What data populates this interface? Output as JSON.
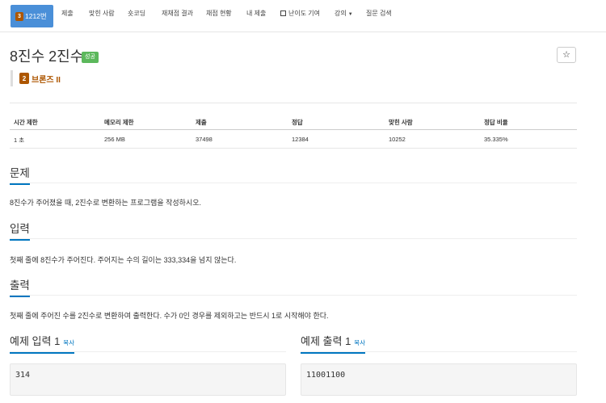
{
  "nav": {
    "active": {
      "tier": "3",
      "label": "1212번"
    },
    "items": [
      "제출",
      "맞힌 사람",
      "숏코딩",
      "재채점 결과",
      "채점 현황",
      "내 제출",
      "난이도 기여",
      "강의",
      "질문 검색"
    ]
  },
  "problem": {
    "title": "8진수 2진수",
    "status": "성공",
    "star": "☆",
    "tier_num": "2",
    "tier_label": "브론즈 II"
  },
  "table": {
    "headers": [
      "시간 제한",
      "메모리 제한",
      "제출",
      "정답",
      "맞힌 사람",
      "정답 비율"
    ],
    "values": [
      "1 초",
      "256 MB",
      "37498",
      "12384",
      "10252",
      "35.335%"
    ]
  },
  "sections": {
    "problem_title": "문제",
    "problem_text": "8진수가 주어졌을 때, 2진수로 변환하는 프로그램을 작성하시오.",
    "input_title": "입력",
    "input_text": "첫째 줄에 8진수가 주어진다. 주어지는 수의 길이는 333,334을 넘지 않는다.",
    "output_title": "출력",
    "output_text": "첫째 줄에 주어진 수를 2진수로 변환하여 출력한다. 수가 0인 경우를 제외하고는 반드시 1로 시작해야 한다."
  },
  "examples": {
    "input_title": "예제 입력 1",
    "output_title": "예제 출력 1",
    "copy": "복사",
    "input_value": "314",
    "output_value": "11001100"
  },
  "colors": {
    "accent": "#0076c0",
    "nav_active": "#4a8fd8",
    "bronze": "#ad5600",
    "success": "#5cb85c"
  }
}
